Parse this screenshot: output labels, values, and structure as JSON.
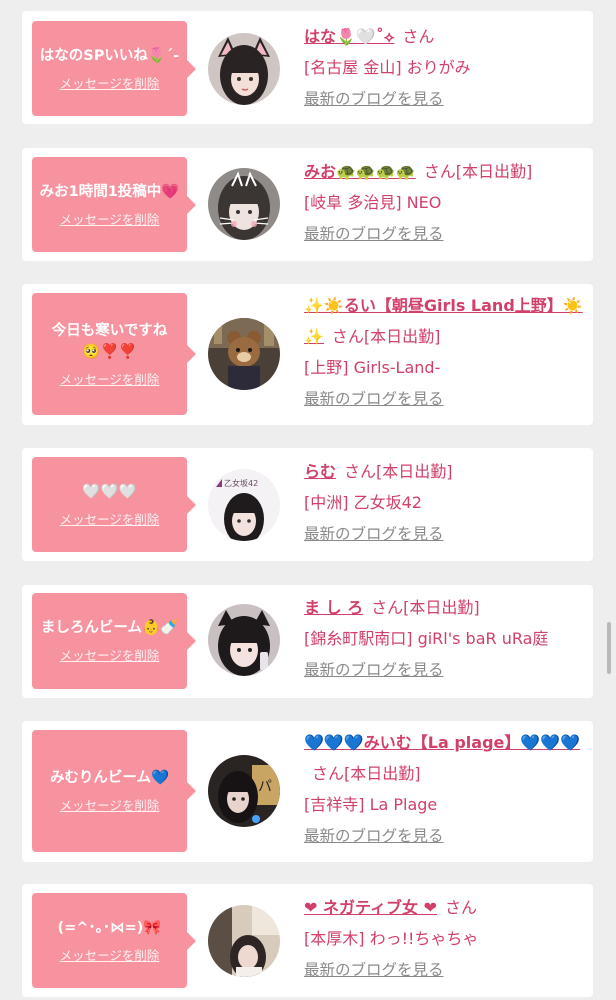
{
  "cards": [
    {
      "message": "はなのSPいいね🌷´-",
      "delete_label": "メッセージを削除",
      "name": "はな🌷🤍˚⟡",
      "suffix": "さん",
      "shop": "[名古屋 金山] おりがみ",
      "blog_label": "最新のブログを見る",
      "avatar_icon": "avatar-girl-cat-ears-icon"
    },
    {
      "message": "みお1時間1投稿中💗",
      "delete_label": "メッセージを削除",
      "name": "みお🐢🐢🐢🐢",
      "suffix": "さん[本日出勤]",
      "shop": "[岐阜 多治見] NEO",
      "blog_label": "最新のブログを見る",
      "avatar_icon": "avatar-girl-cat-filter-icon"
    },
    {
      "message": "今日も寒いですね🥺❣️❣️",
      "delete_label": "メッセージを削除",
      "name": "✨☀️るい【朝昼Girls Land上野】☀️✨",
      "suffix": "さん[本日出勤]",
      "shop": "[上野] Girls-Land-",
      "blog_label": "最新のブログを見る",
      "avatar_icon": "avatar-bear-mask-icon"
    },
    {
      "message": "🤍🤍🤍",
      "delete_label": "メッセージを削除",
      "name": "らむ",
      "suffix": "さん[本日出勤]",
      "shop": "[中洲] 乙女坂42",
      "blog_label": "最新のブログを見る",
      "avatar_icon": "avatar-girl-logo-icon",
      "avatar_text": "乙女坂42"
    },
    {
      "message": "ましろんビーム👶🍼",
      "delete_label": "メッセージを削除",
      "name": "ま し ろ",
      "suffix": "さん[本日出勤]",
      "shop": "[錦糸町駅南口] giRl's baR uRa庭",
      "blog_label": "最新のブログを見る",
      "avatar_icon": "avatar-girl-dark-hair-icon"
    },
    {
      "message": "みむりんビーム💙",
      "delete_label": "メッセージを削除",
      "name": "💙💙💙みいむ【La plage】💙💙💙",
      "suffix": "さん[本日出勤]",
      "shop": "[吉祥寺] La Plage",
      "blog_label": "最新のブログを見る",
      "avatar_icon": "avatar-girl-neon-icon"
    },
    {
      "message": "(=^･｡･⋈=)🎀",
      "delete_label": "メッセージを削除",
      "name": "❤ ネガティブ女 ❤",
      "suffix": "さん",
      "shop": "[本厚木] わっ!!ちゃちゃ",
      "blog_label": "最新のブログを見る",
      "avatar_icon": "avatar-girl-room-icon"
    }
  ],
  "colors": {
    "bubble": "#f7929f",
    "name": "#d2406a",
    "blog_link": "#8a8a8a",
    "background": "#eeeeee"
  }
}
